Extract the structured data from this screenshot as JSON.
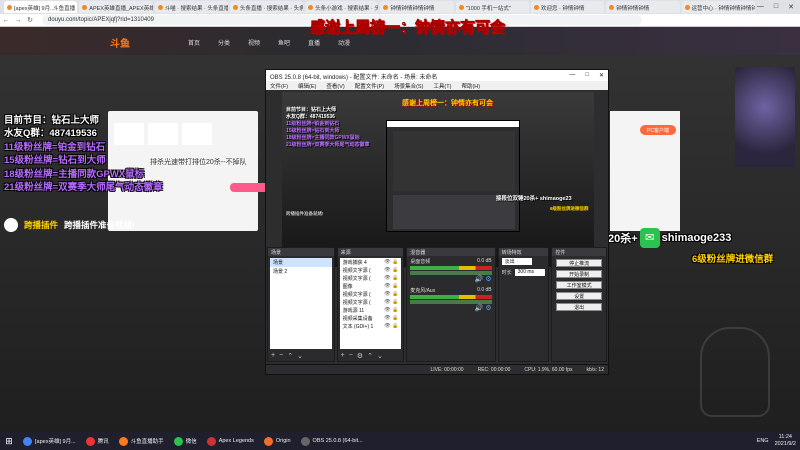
{
  "browser": {
    "tabs": [
      {
        "label": "[apex英雄] 9月..斗鱼直播",
        "active": true
      },
      {
        "label": "APEX英雄直播_APEX英雄直播"
      },
      {
        "label": "斗喵 · 搜索结果 · 头条直播"
      },
      {
        "label": "头条直播 · 搜索结果 · 头条"
      },
      {
        "label": "头条小游戏 · 搜索结果 · 头条"
      },
      {
        "label": "钟情钟情钟情钟情"
      },
      {
        "label": "\"1000 手机一站式\""
      },
      {
        "label": "欢迎您 · 钟情钟情"
      },
      {
        "label": "钟情钟情钟情"
      },
      {
        "label": "运营中心 · 钟情钟情钟情钟情"
      }
    ],
    "window_controls": [
      "—",
      "□",
      "✕"
    ],
    "url": "douyu.com/topic/APEXjqfj?rid=1310409"
  },
  "stream_overlay": {
    "banner_title": "感谢上周榜一：钟情亦有可会",
    "lines": [
      {
        "text": "目前节目：钻石上大师",
        "color": "white"
      },
      {
        "text": "水友Q群：487419536",
        "color": "white"
      },
      {
        "text": "11级粉丝牌=铂金到钻石",
        "color": "purple"
      },
      {
        "text": "15级粉丝牌=钻石到大师",
        "color": "purple"
      },
      {
        "text": "18级粉丝牌=主播同款GPWX鼠标",
        "color": "purple"
      },
      {
        "text": "21级粉丝牌=双赛季大师尾气动态徽章",
        "color": "purple"
      }
    ],
    "plugin": {
      "name": "跨播插件",
      "message": "跨播插件准备就绪!"
    },
    "wechat_promo": "接段位双锤20杀+",
    "wechat_id": "shimaoge233",
    "fan_group": "6级粉丝牌进微信群"
  },
  "douyu": {
    "logo": "斗鱼",
    "nav_items": [
      "首页",
      "分类",
      "视频",
      "鱼吧",
      "直播",
      "动漫"
    ],
    "promo_text": "排杀光速带打排位20杀--不掉队",
    "pc_button": "PC客户端"
  },
  "obs": {
    "title": "OBS 25.0.8 (64-bit, windows) - 配置文件: 未命名 - 场景: 未命名",
    "window_controls": [
      "—",
      "□",
      "✕"
    ],
    "menu": [
      "文件(F)",
      "编辑(E)",
      "查看(V)",
      "配置文件(P)",
      "场景集合(S)",
      "工具(T)",
      "帮助(H)"
    ],
    "preview_title": "感谢上周榜一：钟情亦有可会",
    "preview_wechat": "接段位双锤20杀+ shimaoge23",
    "preview_fan": "6级粉丝牌进微信群",
    "preview_plugin": "跨播插件准备就绪!",
    "docks": {
      "scenes": {
        "title": "场景",
        "items": [
          "场景",
          "场景 2"
        ],
        "selected": 0
      },
      "sources": {
        "title": "来源",
        "items": [
          "游戏捕获 4",
          "视频文字源 (",
          "视频文字源 (",
          "图像",
          "视频文字源 (",
          "视频文字源 (",
          "游戏源 11",
          "视频采集设备",
          "文本 (GDI+) 1"
        ]
      },
      "mixer": {
        "title": "混音器",
        "channels": [
          {
            "name": "桌面音频",
            "level": "0.0 dB"
          },
          {
            "name": "麦克风/Aux",
            "level": "0.0 dB"
          }
        ]
      },
      "transitions": {
        "title": "转场特效",
        "type": "淡出",
        "duration_label": "时长",
        "duration": "300 ms"
      },
      "controls": {
        "title": "控件",
        "buttons": [
          "停止推流",
          "开始录制",
          "工作室模式",
          "设置",
          "退出"
        ]
      }
    },
    "status": {
      "live": "LIVE: 00:00:00",
      "rec": "REC: 00:00:00",
      "cpu": "CPU: 1.9%, 60.00 fps",
      "kbps": "kb/s: 12"
    }
  },
  "taskbar": {
    "items": [
      {
        "label": "[apex英雄] 9月...",
        "color": "#4285f4"
      },
      {
        "label": "腾讯",
        "color": "#e33"
      },
      {
        "label": "斗鱼直播助手",
        "color": "#ff7a1a"
      },
      {
        "label": "微信",
        "color": "#2bc24f"
      },
      {
        "label": "Apex Legends",
        "color": "#c33"
      },
      {
        "label": "Origin",
        "color": "#f56c2d"
      },
      {
        "label": "OBS 25.0.8 (64-bit...",
        "color": "#666"
      }
    ],
    "ime": "ENG",
    "time": "11:24",
    "date": "2021/9/2"
  }
}
